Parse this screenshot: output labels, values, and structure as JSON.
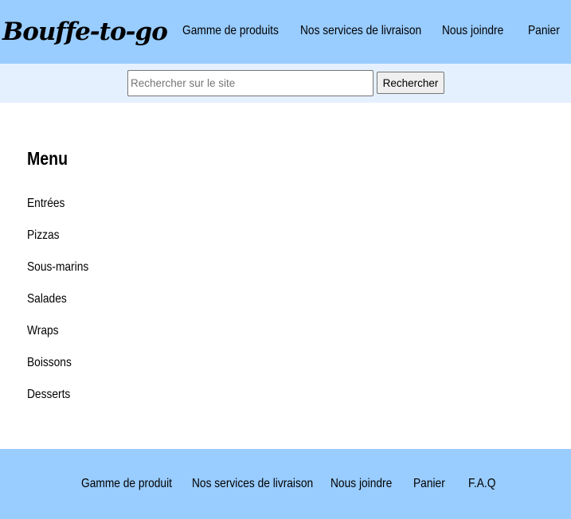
{
  "header": {
    "logo": "Bouffe-to-go",
    "nav": [
      {
        "label": "Gamme de produits"
      },
      {
        "label": "Nos services de livraison"
      },
      {
        "label": "Nous joindre"
      },
      {
        "label": "Panier"
      }
    ]
  },
  "search": {
    "placeholder": "Rechercher sur le site",
    "value": "",
    "button_label": "Rechercher"
  },
  "menu": {
    "title": "Menu",
    "items": [
      {
        "label": "Entrées"
      },
      {
        "label": "Pizzas"
      },
      {
        "label": "Sous-marins"
      },
      {
        "label": "Salades"
      },
      {
        "label": "Wraps"
      },
      {
        "label": "Boissons"
      },
      {
        "label": "Desserts"
      }
    ]
  },
  "footer": {
    "links": [
      {
        "label": "Gamme de produit"
      },
      {
        "label": "Nos services de livraison"
      },
      {
        "label": "Nous joindre"
      },
      {
        "label": "Panier"
      },
      {
        "label": "F.A.Q"
      }
    ]
  },
  "colors": {
    "header_bg": "#99ccff",
    "searchbar_bg": "#e5f0ff",
    "footer_bg": "#99ccff"
  }
}
